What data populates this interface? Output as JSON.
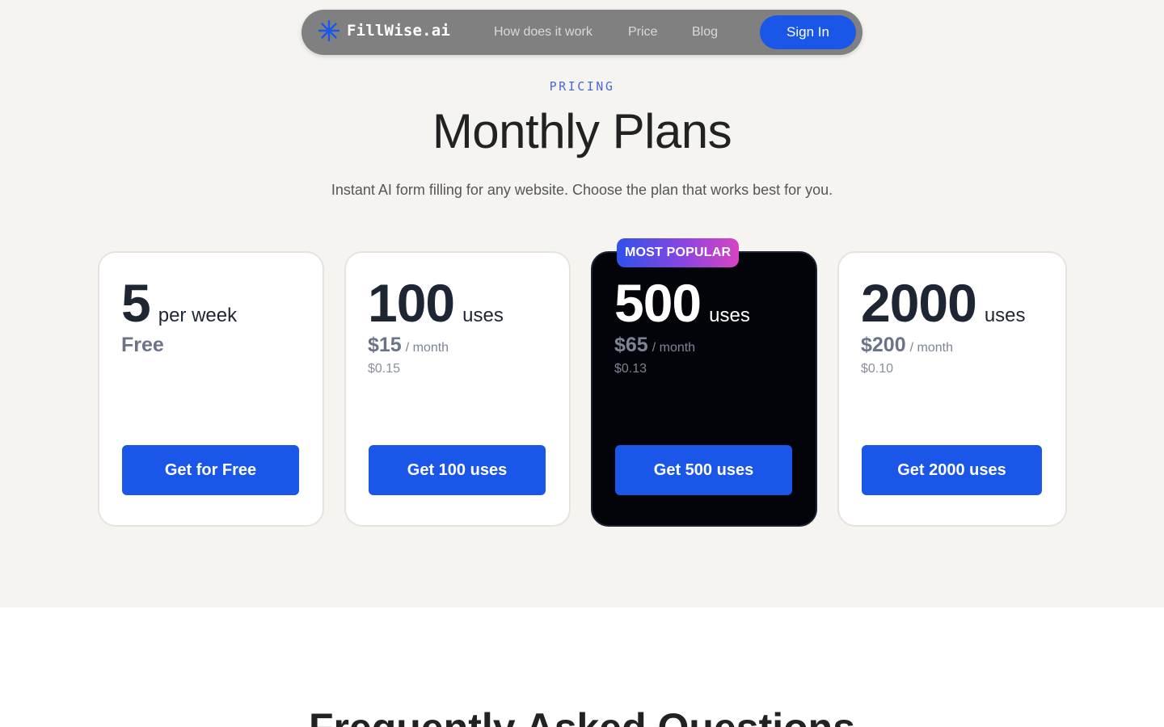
{
  "nav": {
    "brand": "FillWise.ai",
    "brand_icon": "asterisk-icon",
    "links": [
      "How does it work",
      "Price",
      "Blog"
    ],
    "signin_label": "Sign In"
  },
  "header": {
    "eyebrow": "PRICING",
    "title": "Monthly Plans",
    "subtitle": "Instant AI form filling for any website. Choose the plan that works best for you."
  },
  "plans": [
    {
      "qty": "5",
      "unit": "per week",
      "price": "Free",
      "per": "",
      "per_use": "",
      "cta": "Get for Free",
      "featured": false
    },
    {
      "qty": "100",
      "unit": "uses",
      "price": "$15",
      "per": "/ month",
      "per_use": "$0.15",
      "cta": "Get 100 uses",
      "featured": false
    },
    {
      "qty": "500",
      "unit": "uses",
      "price": "$65",
      "per": "/ month",
      "per_use": "$0.13",
      "cta": "Get 500 uses",
      "featured": true,
      "badge": "MOST POPULAR"
    },
    {
      "qty": "2000",
      "unit": "uses",
      "price": "$200",
      "per": "/ month",
      "per_use": "$0.10",
      "cta": "Get 2000 uses",
      "featured": false
    }
  ],
  "faq": {
    "title": "Frequently Asked Questions"
  },
  "colors": {
    "accent": "#1a56e8",
    "page_bg": "#f5f4f1",
    "featured_card_bg": "#03040a",
    "badge_gradient": [
      "#2f52ea",
      "#8b45e0",
      "#d744c3"
    ]
  }
}
